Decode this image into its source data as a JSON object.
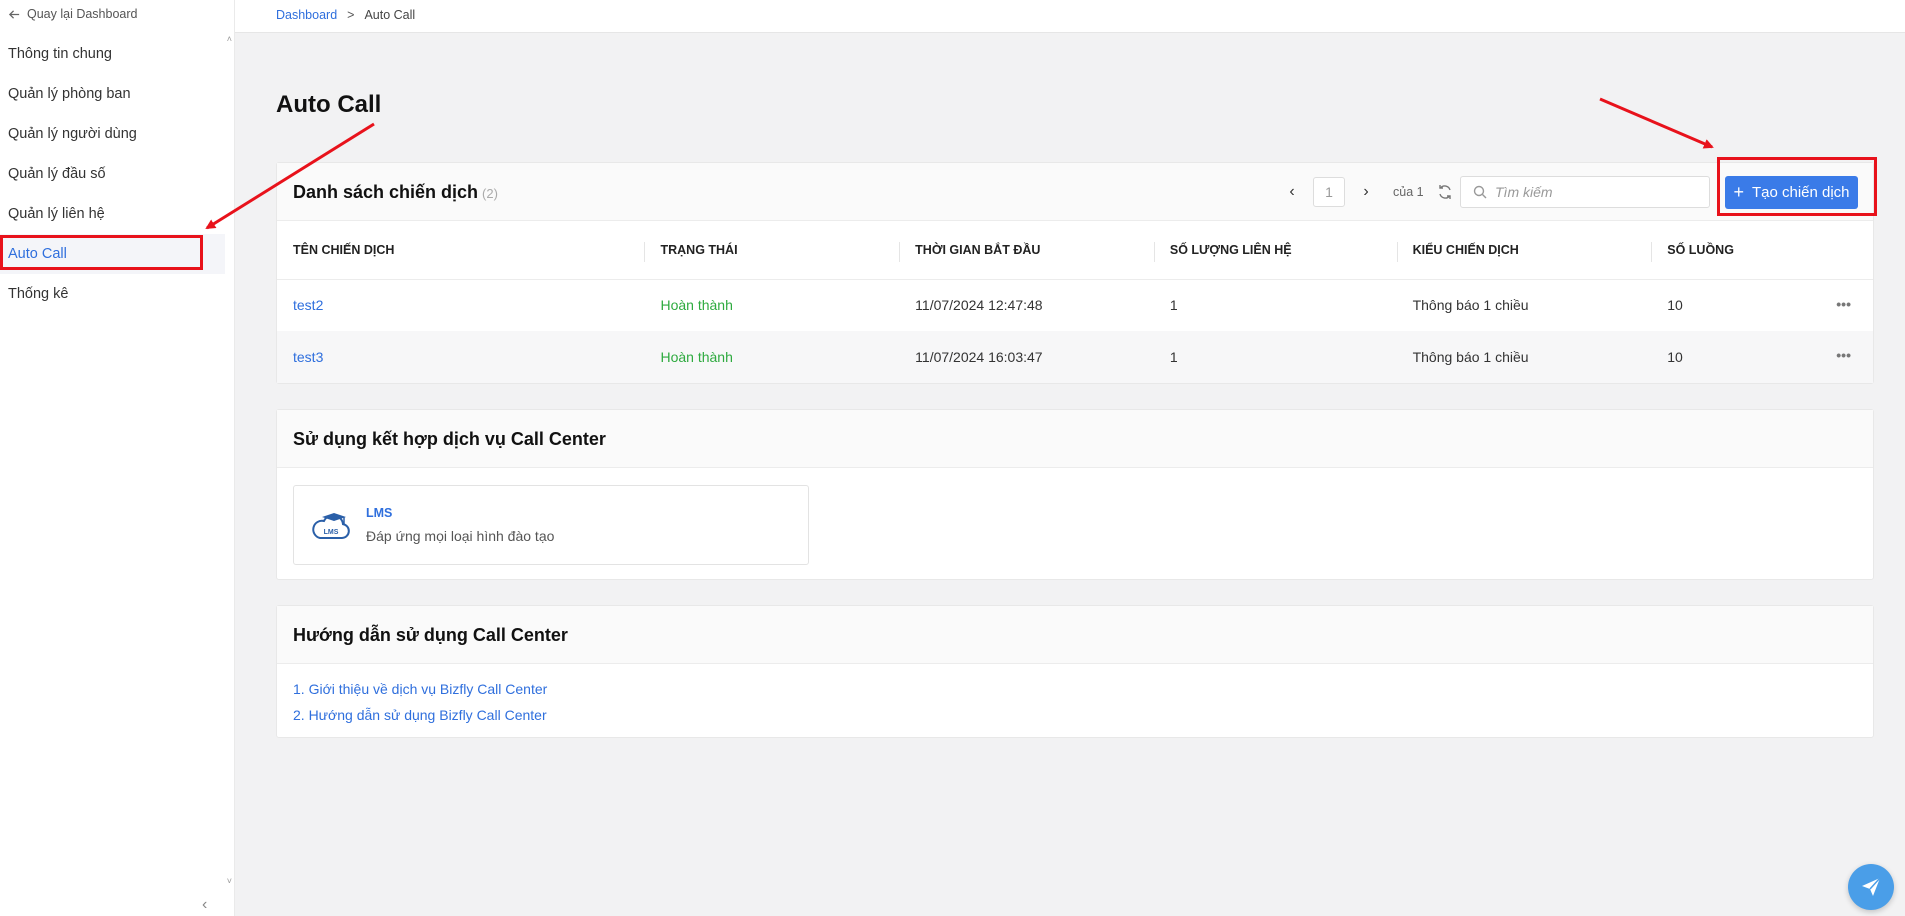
{
  "sidebar": {
    "back_label": "Quay lại Dashboard",
    "items": [
      {
        "label": "Thông tin chung"
      },
      {
        "label": "Quản lý phòng ban"
      },
      {
        "label": "Quản lý người dùng"
      },
      {
        "label": "Quản lý đầu số"
      },
      {
        "label": "Quản lý liên hệ"
      },
      {
        "label": "Auto Call",
        "active": true
      },
      {
        "label": "Thống kê"
      }
    ]
  },
  "breadcrumb": {
    "root": "Dashboard",
    "separator": ">",
    "current": "Auto Call"
  },
  "page_title": "Auto Call",
  "campaigns": {
    "title": "Danh sách chiến dịch",
    "count": "(2)",
    "pager": {
      "page": "1",
      "of_label": "của 1"
    },
    "search_placeholder": "Tìm kiếm",
    "create_label": "Tạo chiến dịch",
    "columns": [
      "TÊN CHIẾN DỊCH",
      "TRẠNG THÁI",
      "THỜI GIAN BẮT ĐẦU",
      "SỐ LƯỢNG LIÊN HỆ",
      "KIỂU CHIẾN DỊCH",
      "SỐ LUỒNG"
    ],
    "rows": [
      {
        "name": "test2",
        "status": "Hoàn thành",
        "start": "11/07/2024 12:47:48",
        "contacts": "1",
        "type": "Thông báo 1 chiều",
        "threads": "10",
        "more": "•••"
      },
      {
        "name": "test3",
        "status": "Hoàn thành",
        "start": "11/07/2024 16:03:47",
        "contacts": "1",
        "type": "Thông báo 1 chiều",
        "threads": "10",
        "more": "•••"
      }
    ]
  },
  "integration": {
    "title": "Sử dụng kết hợp dịch vụ Call Center",
    "service": {
      "name": "LMS",
      "description": "Đáp ứng mọi loại hình đào tạo",
      "icon": "cloud-graduation-icon",
      "icon_text": "LMS"
    }
  },
  "guide": {
    "title": "Hướng dẫn sử dụng Call Center",
    "links": [
      "1. Giới thiệu về dịch vụ Bizfly Call Center",
      "2. Hướng dẫn sử dụng Bizfly Call Center"
    ]
  },
  "colors": {
    "accent": "#3a7be8",
    "link": "#2f6fdd",
    "success": "#2eaa3f",
    "annotation": "#e8121b"
  }
}
